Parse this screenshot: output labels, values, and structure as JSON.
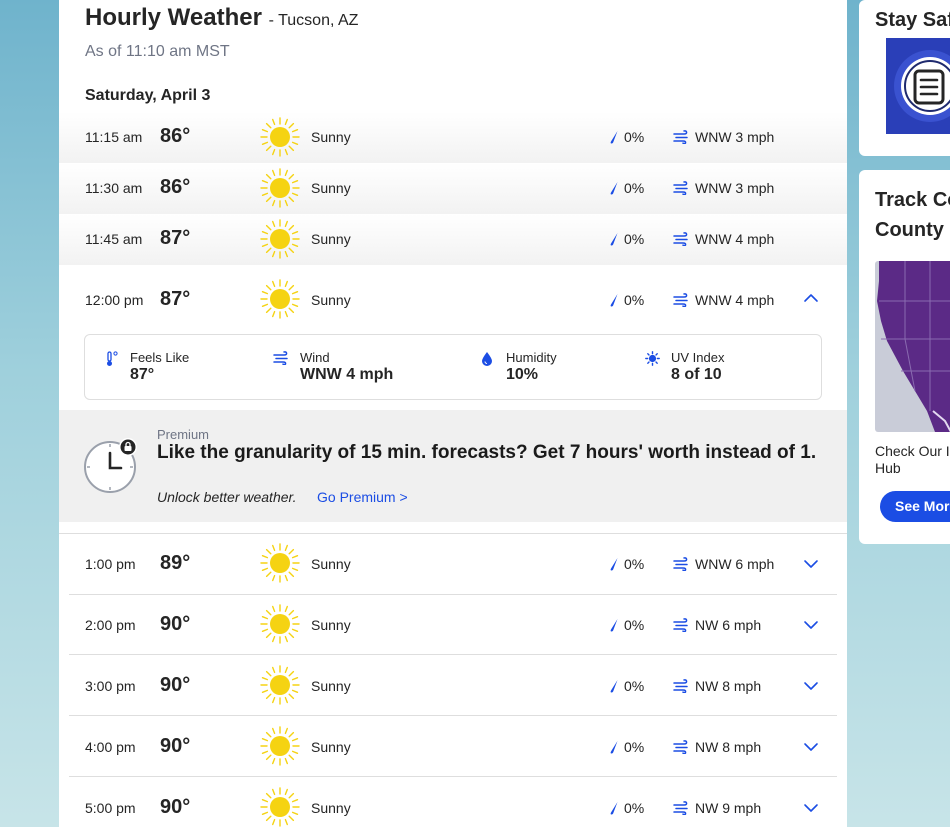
{
  "header": {
    "title": "Hourly Weather",
    "location": "- Tucson, AZ",
    "as_of": "As of 11:10 am MST",
    "day": "Saturday, April 3"
  },
  "colors": {
    "accent": "#1b4de4",
    "sun": "#f5d312",
    "premium_bg": "#f0f0f0"
  },
  "hours": [
    {
      "time": "11:15 am",
      "temp": "86°",
      "cond": "Sunny",
      "precip": "0%",
      "wind": "WNW 3 mph"
    },
    {
      "time": "11:30 am",
      "temp": "86°",
      "cond": "Sunny",
      "precip": "0%",
      "wind": "WNW 3 mph"
    },
    {
      "time": "11:45 am",
      "temp": "87°",
      "cond": "Sunny",
      "precip": "0%",
      "wind": "WNW 4 mph"
    },
    {
      "time": "12:00 pm",
      "temp": "87°",
      "cond": "Sunny",
      "precip": "0%",
      "wind": "WNW 4 mph"
    },
    {
      "time": "1:00 pm",
      "temp": "89°",
      "cond": "Sunny",
      "precip": "0%",
      "wind": "WNW 6 mph"
    },
    {
      "time": "2:00 pm",
      "temp": "90°",
      "cond": "Sunny",
      "precip": "0%",
      "wind": "NW 6 mph"
    },
    {
      "time": "3:00 pm",
      "temp": "90°",
      "cond": "Sunny",
      "precip": "0%",
      "wind": "NW 8 mph"
    },
    {
      "time": "4:00 pm",
      "temp": "90°",
      "cond": "Sunny",
      "precip": "0%",
      "wind": "NW 8 mph"
    },
    {
      "time": "5:00 pm",
      "temp": "90°",
      "cond": "Sunny",
      "precip": "0%",
      "wind": "NW 9 mph"
    }
  ],
  "details": {
    "feels_like_label": "Feels Like",
    "feels_like": "87°",
    "wind_label": "Wind",
    "wind": "WNW 4 mph",
    "humidity_label": "Humidity",
    "humidity": "10%",
    "uv_label": "UV Index",
    "uv": "8 of 10"
  },
  "premium": {
    "label": "Premium",
    "headline": "Like the granularity of 15 min. forecasts? Get 7 hours' worth instead of 1.",
    "sub": "Unlock better weather.",
    "link": "Go Premium >"
  },
  "sidebar": {
    "card1_title": "Stay Saf",
    "card2_title_line1": "Track Co",
    "card2_title_line2": "County",
    "card2_text_line1": "Check Our I",
    "card2_text_line2": "Hub",
    "see_more": "See More"
  },
  "icons": {
    "sun": "sun-icon",
    "drop": "rain-drop-icon",
    "wind": "wind-icon",
    "chevron_up": "chevron-up-icon",
    "chevron_down": "chevron-down-icon",
    "thermometer": "thermometer-icon",
    "humidity": "humidity-drop-icon",
    "uv": "uv-icon",
    "clock": "clock-lock-icon",
    "document": "document-icon",
    "map": "map-icon"
  }
}
